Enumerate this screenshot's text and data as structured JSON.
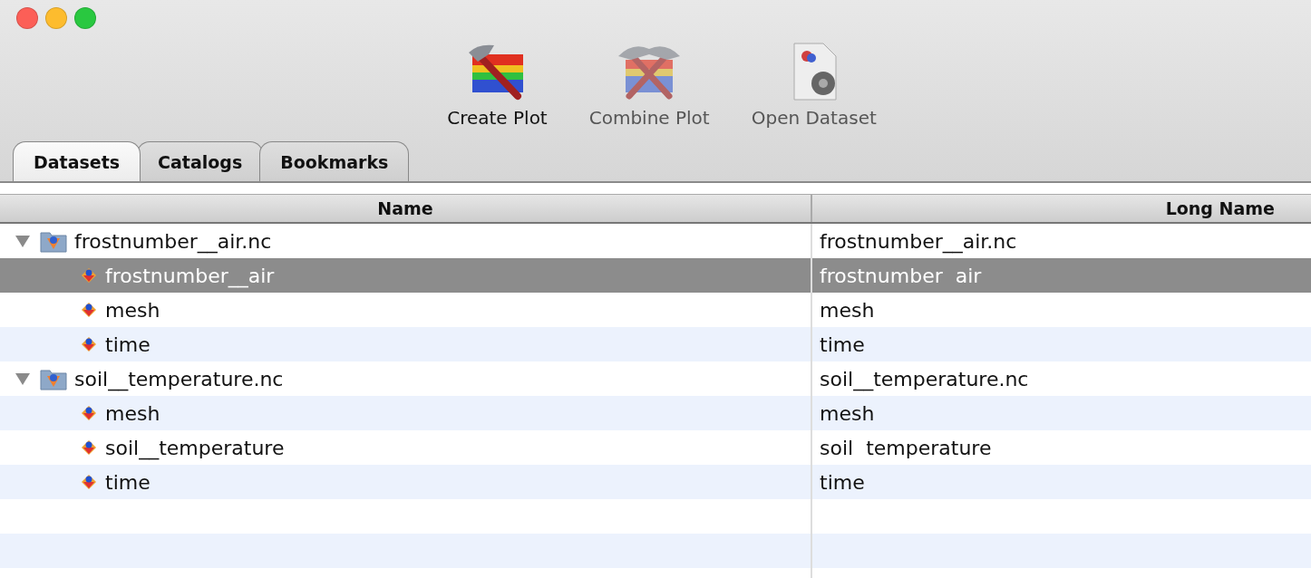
{
  "window": {
    "controls": [
      {
        "kind": "close"
      },
      {
        "kind": "minimize"
      },
      {
        "kind": "zoom"
      }
    ]
  },
  "toolbar": [
    {
      "kind": "create",
      "label": "Create Plot",
      "disabled": false
    },
    {
      "kind": "combine",
      "label": "Combine Plot",
      "disabled": true
    },
    {
      "kind": "open",
      "label": "Open Dataset",
      "disabled": true
    }
  ],
  "tabs": [
    {
      "label": "Datasets",
      "selected": true
    },
    {
      "label": "Catalogs",
      "selected": false
    },
    {
      "label": "Bookmarks",
      "selected": false
    }
  ],
  "table": {
    "columns": [
      "Name",
      "Long Name"
    ],
    "rows": [
      {
        "kind": "dataset",
        "name": "frostnumber__air.nc",
        "long_name": "frostnumber__air.nc",
        "expanded": true,
        "selected": false,
        "children": [
          {
            "kind": "variable",
            "name": "frostnumber__air",
            "long_name": "frostnumber  air",
            "selected": true
          },
          {
            "kind": "variable",
            "name": "mesh",
            "long_name": "mesh",
            "selected": false
          },
          {
            "kind": "variable",
            "name": "time",
            "long_name": "time",
            "selected": false
          }
        ]
      },
      {
        "kind": "dataset",
        "name": "soil__temperature.nc",
        "long_name": "soil__temperature.nc",
        "expanded": true,
        "selected": false,
        "children": [
          {
            "kind": "variable",
            "name": "mesh",
            "long_name": "mesh",
            "selected": false
          },
          {
            "kind": "variable",
            "name": "soil__temperature",
            "long_name": "soil  temperature",
            "selected": false
          },
          {
            "kind": "variable",
            "name": "time",
            "long_name": "time",
            "selected": false
          }
        ]
      }
    ]
  }
}
